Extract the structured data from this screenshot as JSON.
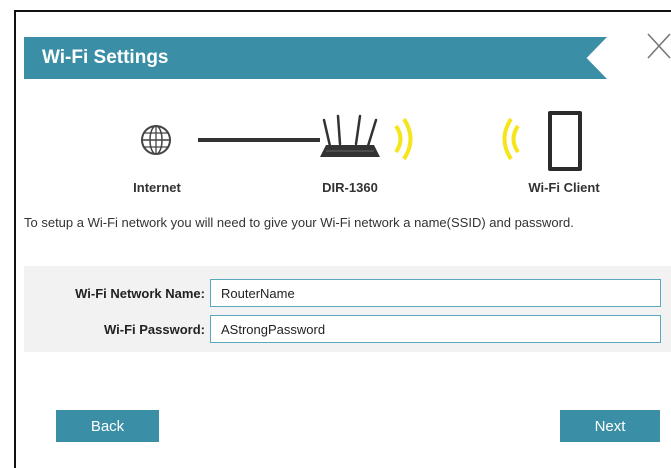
{
  "dialog": {
    "title": "Wi-Fi Settings",
    "description": "To setup a Wi-Fi network you will need to give your Wi-Fi network a name(SSID) and password."
  },
  "diagram": {
    "internet_label": "Internet",
    "router_label": "DIR-1360",
    "client_label": "Wi-Fi Client"
  },
  "form": {
    "network_name_label": "Wi-Fi Network Name:",
    "network_name_value": "RouterName",
    "password_label": "Wi-Fi Password:",
    "password_value": "AStrongPassword"
  },
  "buttons": {
    "back_label": "Back",
    "next_label": "Next"
  },
  "colors": {
    "accent": "#3a8fa6",
    "wifi_signal": "#f5e51a"
  }
}
